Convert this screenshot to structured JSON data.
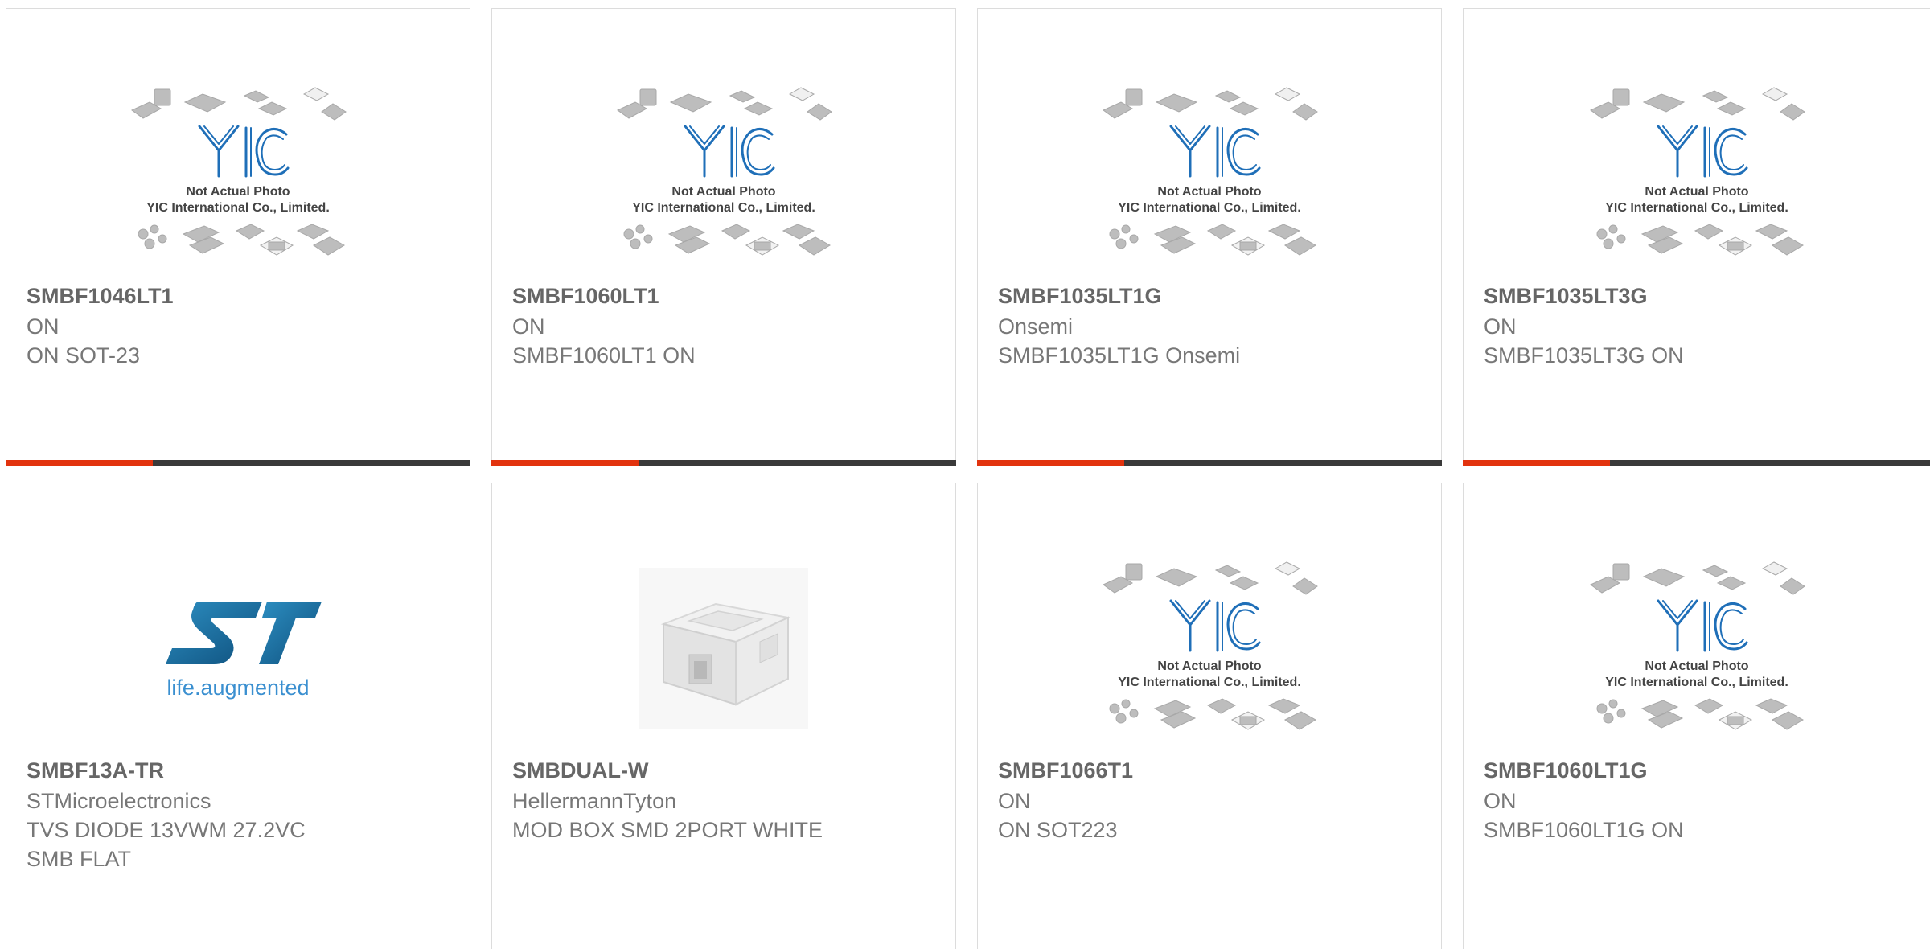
{
  "placeholder": {
    "brand": "YIC",
    "line1": "Not Actual Photo",
    "line2": "YIC International Co., Limited."
  },
  "st_logo": {
    "tagline": "life.augmented"
  },
  "products": [
    {
      "part": "SMBF1046LT1",
      "brand": "ON",
      "desc": [
        "ON SOT-23"
      ],
      "image": "yic-placeholder"
    },
    {
      "part": "SMBF1060LT1",
      "brand": "ON",
      "desc": [
        "SMBF1060LT1 ON"
      ],
      "image": "yic-placeholder"
    },
    {
      "part": "SMBF1035LT1G",
      "brand": "Onsemi",
      "desc": [
        "SMBF1035LT1G Onsemi"
      ],
      "image": "yic-placeholder"
    },
    {
      "part": "SMBF1035LT3G",
      "brand": "ON",
      "desc": [
        "SMBF1035LT3G ON"
      ],
      "image": "yic-placeholder"
    },
    {
      "part": "SMBF13A-TR",
      "brand": "STMicroelectronics",
      "desc": [
        "TVS DIODE 13VWM 27.2VC",
        "SMB FLAT"
      ],
      "image": "st-logo"
    },
    {
      "part": "SMBDUAL-W",
      "brand": "HellermannTyton",
      "desc": [
        "MOD BOX SMD 2PORT WHITE"
      ],
      "image": "white-box-photo"
    },
    {
      "part": "SMBF1066T1",
      "brand": "ON",
      "desc": [
        "ON SOT223"
      ],
      "image": "yic-placeholder"
    },
    {
      "part": "SMBF1060LT1G",
      "brand": "ON",
      "desc": [
        "SMBF1060LT1G ON"
      ],
      "image": "yic-placeholder"
    }
  ],
  "colors": {
    "accent": "#e2330e",
    "bar": "#3a3a3a",
    "title": "#666666",
    "text": "#777777",
    "yic_blue": "#1f6fb8"
  }
}
